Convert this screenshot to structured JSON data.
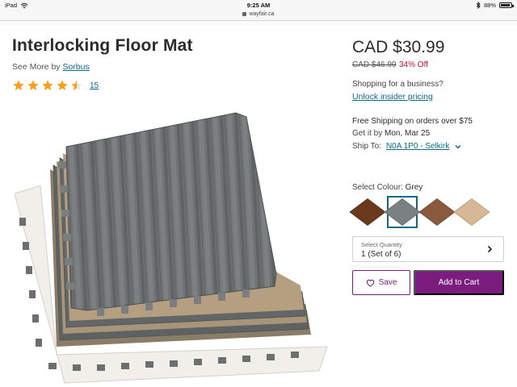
{
  "status_bar": {
    "device": "iPad",
    "time": "9:25 AM",
    "battery": "88%"
  },
  "browser": {
    "url": "wayfair.ca"
  },
  "product": {
    "title": "Interlocking Floor Mat",
    "see_more_prefix": "See More by",
    "brand": "Sorbus",
    "rating_value": 4.5,
    "rating_count": "15",
    "price": "CAD $30.99",
    "original_price": "CAD $46.99",
    "discount": "34% Off"
  },
  "business": {
    "question": "Shopping for a business?",
    "link": "Unlock insider pricing"
  },
  "shipping": {
    "free_shipping": "Free Shipping on orders over $75",
    "get_it_by_prefix": "Get it by",
    "get_it_by_date": "Mon, Mar 25",
    "ship_to_prefix": "Ship To:",
    "ship_to_location": "N0A 1P0 - Selkirk"
  },
  "colour": {
    "label": "Select Colour:",
    "selected": "Grey",
    "swatches": [
      {
        "name": "brown",
        "color": "#6b3a1e",
        "selected": false
      },
      {
        "name": "grey",
        "color": "#7b8080",
        "selected": true
      },
      {
        "name": "walnut",
        "color": "#8a5a3c",
        "selected": false
      },
      {
        "name": "light-oak",
        "color": "#d7b894",
        "selected": false
      }
    ]
  },
  "quantity": {
    "label": "Select Quantity",
    "value": "1 (Set of 6)"
  },
  "actions": {
    "save_label": "Save",
    "add_to_cart_label": "Add to Cart"
  },
  "colors": {
    "accent_purple": "#7b1c7f",
    "link_teal": "#0b6b82",
    "sale_red": "#c8102e",
    "star_orange": "#f5a11c"
  },
  "icons": [
    "wifi-icon",
    "bluetooth-icon",
    "battery-icon",
    "lock-icon",
    "star-icon",
    "chevron-down-icon",
    "chevron-right-icon",
    "heart-icon"
  ]
}
